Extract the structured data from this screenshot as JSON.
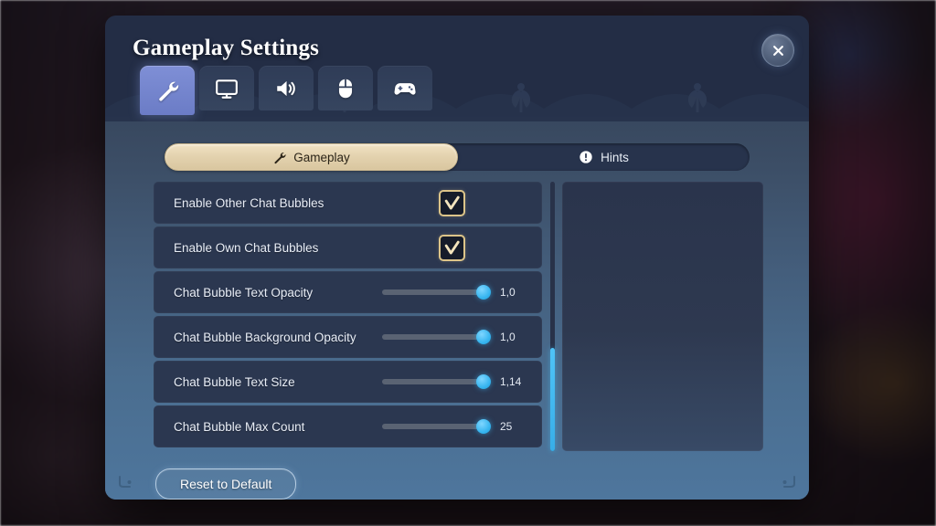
{
  "window": {
    "title": "Gameplay Settings",
    "close_icon": "close-x-icon"
  },
  "tabs": [
    {
      "id": "gameplay",
      "icon": "wrench-icon",
      "active": true
    },
    {
      "id": "video",
      "icon": "monitor-icon",
      "active": false
    },
    {
      "id": "audio",
      "icon": "speaker-icon",
      "active": false
    },
    {
      "id": "controls",
      "icon": "mouse-icon",
      "active": false
    },
    {
      "id": "gamepad",
      "icon": "gamepad-icon",
      "active": false
    }
  ],
  "subtabs": [
    {
      "id": "gameplay",
      "label": "Gameplay",
      "icon": "wrench-icon",
      "active": true
    },
    {
      "id": "hints",
      "label": "Hints",
      "icon": "exclamation-icon",
      "active": false
    }
  ],
  "settings": [
    {
      "label": "Enable Other Chat Bubbles",
      "type": "checkbox",
      "checked": true
    },
    {
      "label": "Enable Own Chat Bubbles",
      "type": "checkbox",
      "checked": true
    },
    {
      "label": "Chat Bubble Text Opacity",
      "type": "slider",
      "value": "1,0",
      "fill_percent": 100
    },
    {
      "label": "Chat Bubble Background Opacity",
      "type": "slider",
      "value": "1,0",
      "fill_percent": 100
    },
    {
      "label": "Chat Bubble Text Size",
      "type": "slider",
      "value": "1,14",
      "fill_percent": 100
    },
    {
      "label": "Chat Bubble Max Count",
      "type": "slider",
      "value": "25",
      "fill_percent": 100
    }
  ],
  "footer": {
    "reset_label": "Reset to Default"
  },
  "scrollbar": {
    "thumb_position": "bottom",
    "thumb_percent": 38
  },
  "colors": {
    "accent_blue": "#4fc3f7",
    "active_tab": "#7f8fd6",
    "checkbox_border": "#dcc489",
    "subtab_active": "#e3d2ae",
    "panel_dark": "#2b3750",
    "dialog_bottom": "#4e769d"
  }
}
